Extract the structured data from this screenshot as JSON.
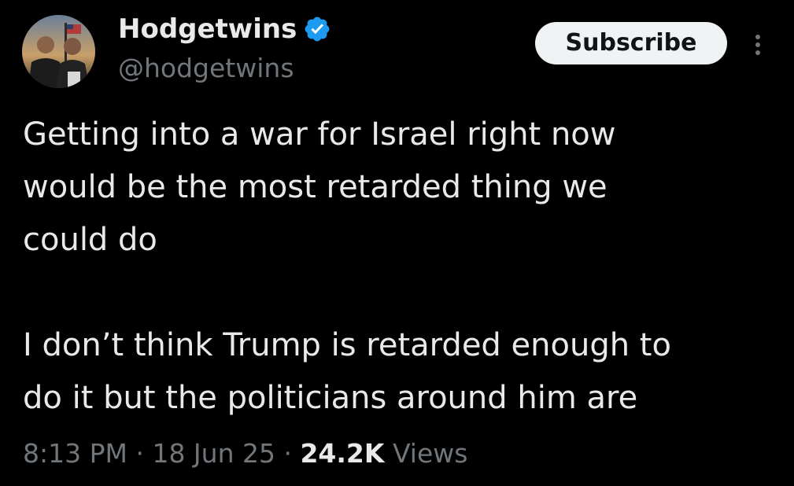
{
  "author": {
    "display_name": "Hodgetwins",
    "handle": "@hodgetwins",
    "verified": true,
    "verified_color": "#1d9bf0"
  },
  "actions": {
    "subscribe_label": "Subscribe",
    "more_icon": "more-vertical-icon"
  },
  "tweet": {
    "lines": [
      "Getting into a war for Israel right now",
      "would be the most retarded thing we",
      "could do",
      "",
      "I don’t think Trump is retarded enough to",
      "do it but the politicians around him are"
    ]
  },
  "meta": {
    "time": "8:13 PM",
    "separator": " · ",
    "date": "18 Jun 25",
    "views_count": "24.2K",
    "views_label": " Views"
  },
  "colors": {
    "background": "#000000",
    "text": "#e7e9ea",
    "secondary": "#71767b",
    "button_bg": "#eff3f4",
    "button_text": "#0f1419"
  }
}
